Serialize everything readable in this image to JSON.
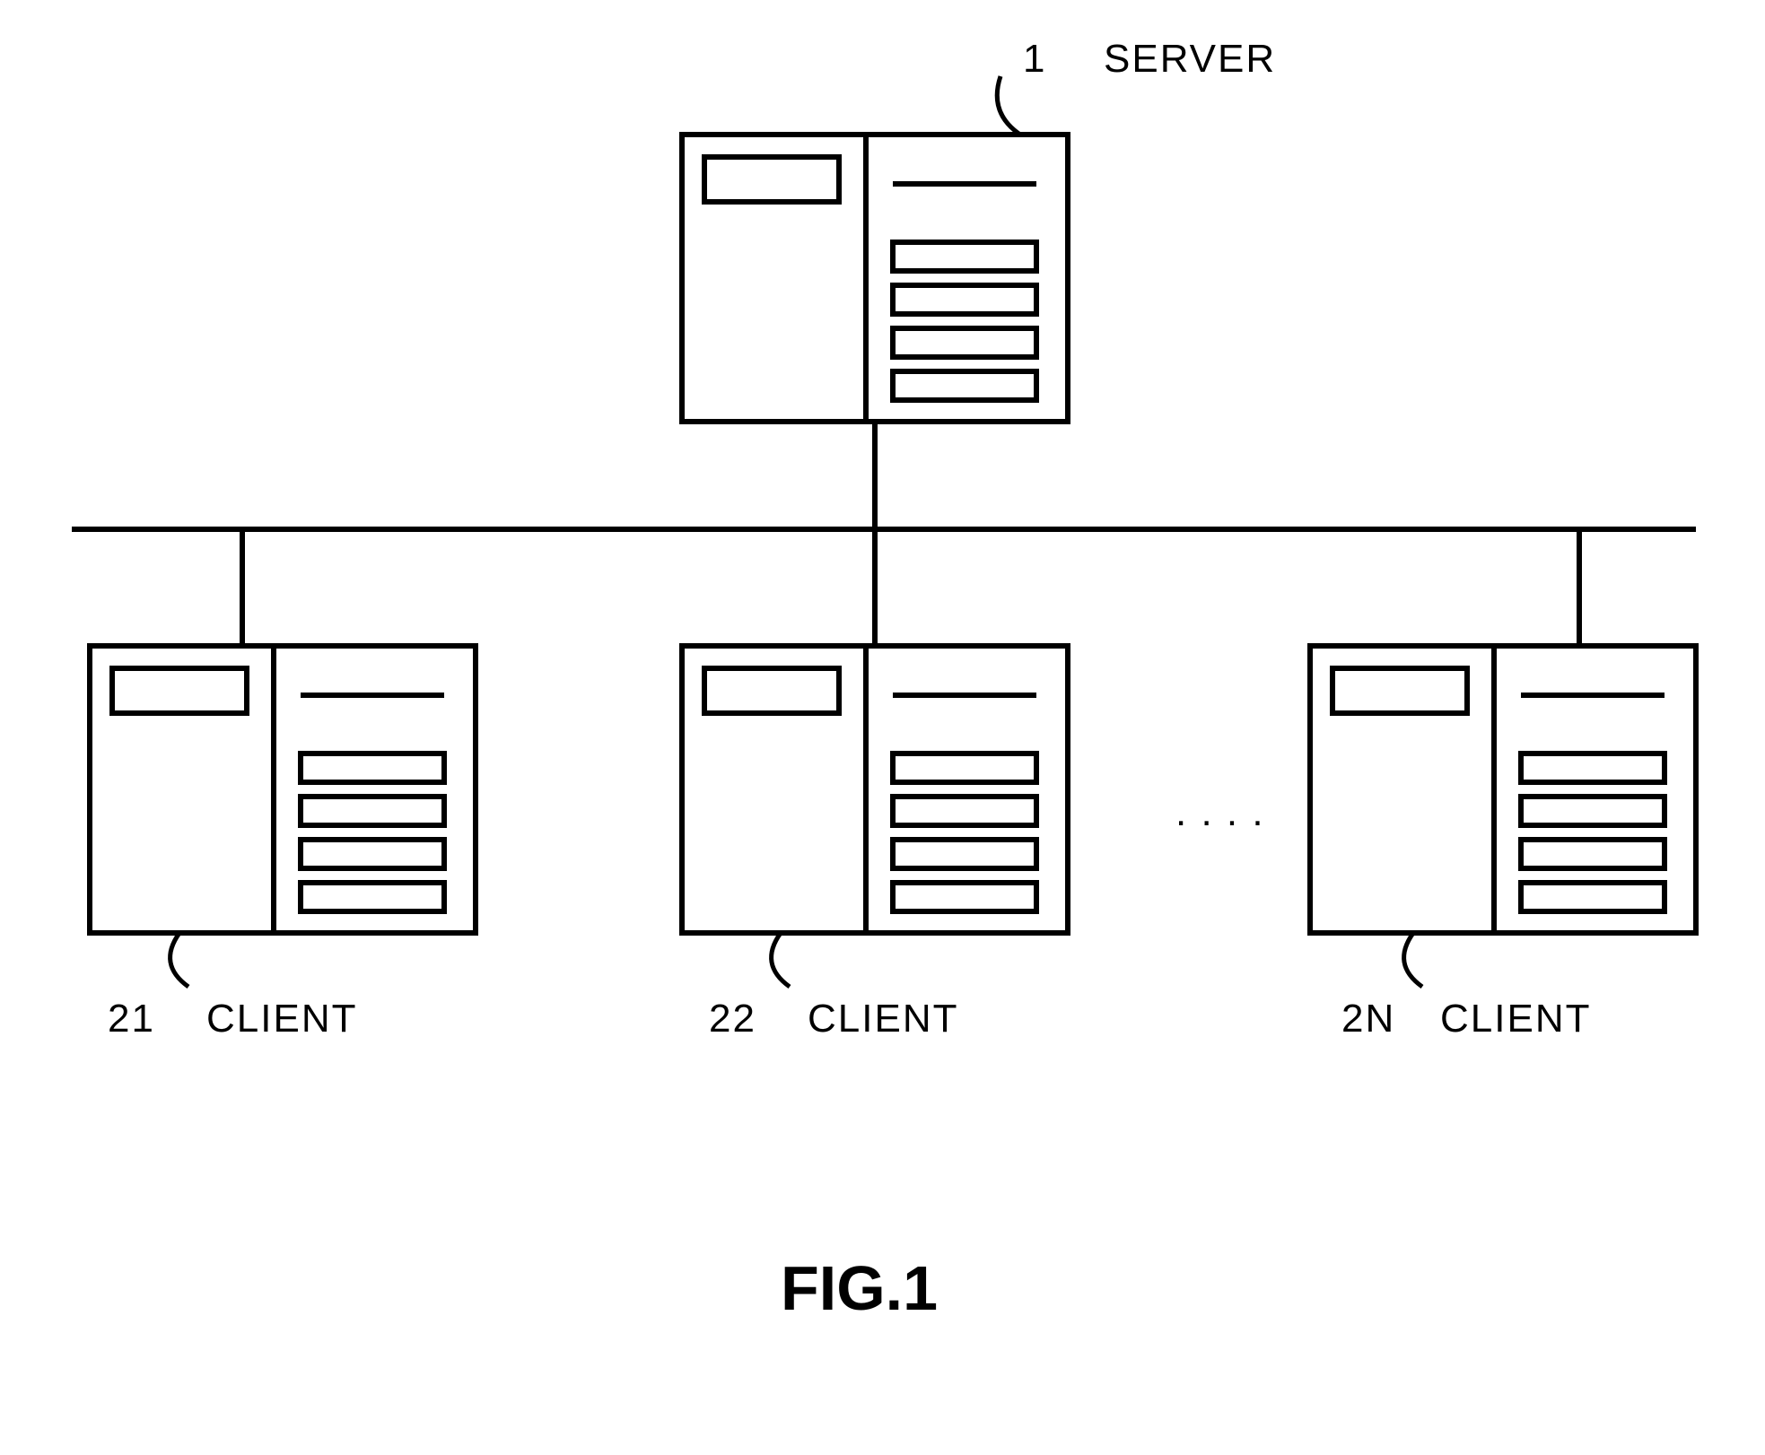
{
  "figureLabel": "FIG.1",
  "nodes": {
    "server": {
      "ref": "1",
      "label": "SERVER"
    },
    "client1": {
      "ref": "21",
      "label": "CLIENT"
    },
    "client2": {
      "ref": "22",
      "label": "CLIENT"
    },
    "clientN": {
      "ref": "2N",
      "label": "CLIENT"
    }
  },
  "ellipsis": ". . . ."
}
